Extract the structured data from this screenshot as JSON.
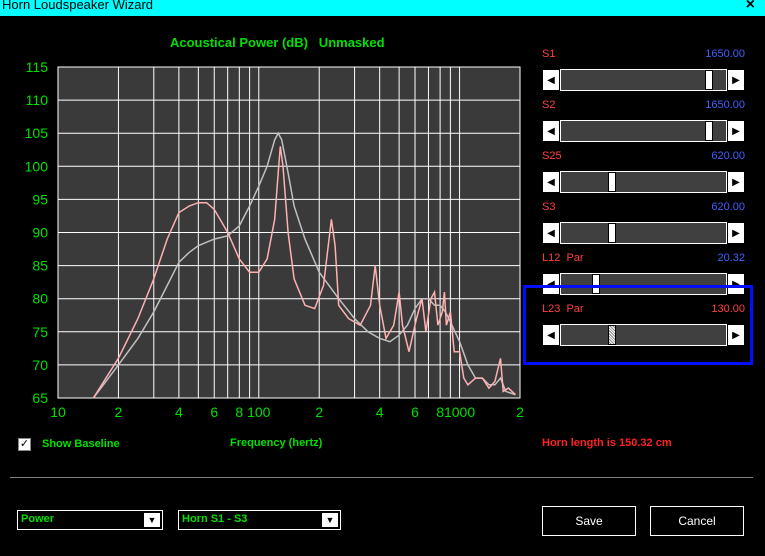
{
  "window": {
    "title": "Horn Loudspeaker Wizard",
    "close_glyph": "×"
  },
  "chart_data": {
    "type": "line",
    "title": "Acoustical Power (dB)   Unmasked",
    "xlabel": "Frequency (hertz)",
    "ylabel": "",
    "x_scale": "log",
    "xlim": [
      10,
      2000
    ],
    "ylim": [
      65,
      115
    ],
    "y_ticks": [
      115,
      110,
      105,
      100,
      95,
      90,
      85,
      80,
      75,
      70,
      65
    ],
    "x_ticks": [
      {
        "value": 10,
        "label": "10"
      },
      {
        "value": 20,
        "label": "2"
      },
      {
        "value": 40,
        "label": "4"
      },
      {
        "value": 60,
        "label": "6"
      },
      {
        "value": 80,
        "label": "8"
      },
      {
        "value": 100,
        "label": "100"
      },
      {
        "value": 200,
        "label": "2"
      },
      {
        "value": 400,
        "label": "4"
      },
      {
        "value": 600,
        "label": "6"
      },
      {
        "value": 800,
        "label": "8"
      },
      {
        "value": 1000,
        "label": "1000"
      },
      {
        "value": 2000,
        "label": "2"
      }
    ],
    "grid": true,
    "colors": {
      "plot_bg": "#3a3a3a",
      "grid": "#ffffff",
      "axis_text": "#00e000",
      "series_1": "#ffb0b0",
      "series_2": "#c0c0c0"
    },
    "series": [
      {
        "color": "#ffb0b0",
        "points": [
          [
            15,
            65
          ],
          [
            20,
            71
          ],
          [
            25,
            77
          ],
          [
            30,
            83
          ],
          [
            35,
            89
          ],
          [
            40,
            93
          ],
          [
            45,
            94
          ],
          [
            50,
            94.5
          ],
          [
            55,
            94.5
          ],
          [
            60,
            93.5
          ],
          [
            70,
            90
          ],
          [
            80,
            86
          ],
          [
            90,
            84
          ],
          [
            100,
            84
          ],
          [
            110,
            86
          ],
          [
            120,
            92
          ],
          [
            125,
            99
          ],
          [
            128,
            103
          ],
          [
            132,
            100
          ],
          [
            140,
            90
          ],
          [
            150,
            83
          ],
          [
            170,
            79
          ],
          [
            190,
            78.5
          ],
          [
            210,
            82
          ],
          [
            230,
            92
          ],
          [
            240,
            88
          ],
          [
            250,
            79
          ],
          [
            280,
            77
          ],
          [
            320,
            76
          ],
          [
            360,
            79
          ],
          [
            380,
            85
          ],
          [
            400,
            79
          ],
          [
            430,
            74
          ],
          [
            470,
            76
          ],
          [
            500,
            81
          ],
          [
            520,
            76
          ],
          [
            560,
            72
          ],
          [
            610,
            77
          ],
          [
            650,
            80
          ],
          [
            680,
            75
          ],
          [
            720,
            80
          ],
          [
            750,
            81
          ],
          [
            780,
            76
          ],
          [
            820,
            78
          ],
          [
            840,
            81
          ],
          [
            860,
            76
          ],
          [
            900,
            78
          ],
          [
            940,
            72
          ],
          [
            1000,
            72
          ],
          [
            1050,
            68
          ],
          [
            1100,
            67
          ],
          [
            1200,
            68
          ],
          [
            1300,
            68
          ],
          [
            1400,
            66.5
          ],
          [
            1500,
            67.5
          ],
          [
            1600,
            71
          ],
          [
            1650,
            66
          ],
          [
            1750,
            66.5
          ],
          [
            1900,
            65.5
          ]
        ]
      },
      {
        "color": "#c0c0c0",
        "points": [
          [
            15,
            65
          ],
          [
            20,
            70
          ],
          [
            25,
            74
          ],
          [
            30,
            78
          ],
          [
            35,
            82
          ],
          [
            40,
            85.5
          ],
          [
            45,
            87
          ],
          [
            50,
            88
          ],
          [
            60,
            89
          ],
          [
            70,
            89.5
          ],
          [
            80,
            91
          ],
          [
            90,
            94
          ],
          [
            100,
            97
          ],
          [
            110,
            100
          ],
          [
            120,
            104
          ],
          [
            125,
            105
          ],
          [
            130,
            104
          ],
          [
            140,
            99
          ],
          [
            150,
            94
          ],
          [
            170,
            89
          ],
          [
            200,
            84
          ],
          [
            250,
            80
          ],
          [
            300,
            77
          ],
          [
            350,
            75
          ],
          [
            400,
            74
          ],
          [
            450,
            73.5
          ],
          [
            500,
            74.5
          ],
          [
            550,
            76
          ],
          [
            600,
            78.5
          ],
          [
            650,
            80
          ],
          [
            700,
            80
          ],
          [
            750,
            79
          ],
          [
            800,
            79
          ],
          [
            850,
            78
          ],
          [
            900,
            76.5
          ],
          [
            1000,
            73.5
          ],
          [
            1100,
            70
          ],
          [
            1200,
            68
          ],
          [
            1300,
            68
          ],
          [
            1400,
            67
          ],
          [
            1500,
            67
          ],
          [
            1600,
            68
          ],
          [
            1700,
            66
          ],
          [
            1900,
            65.5
          ]
        ]
      }
    ]
  },
  "sliders": [
    {
      "label": "S1",
      "value": "1650.00",
      "fraction": 0.92,
      "value_color": "blue"
    },
    {
      "label": "S2",
      "value": "1650.00",
      "fraction": 0.92,
      "value_color": "blue"
    },
    {
      "label": "S25",
      "value": "620.00",
      "fraction": 0.3,
      "value_color": "blue"
    },
    {
      "label": "S3",
      "value": "620.00",
      "fraction": 0.3,
      "value_color": "blue"
    },
    {
      "label": "L12  Par",
      "value": "20.32",
      "fraction": 0.2,
      "value_color": "blue"
    },
    {
      "label": "L23  Par",
      "value": "130.00",
      "fraction": 0.3,
      "value_color": "red"
    }
  ],
  "show_baseline": {
    "label": "Show Baseline",
    "checked": true,
    "check_glyph": "✓"
  },
  "horn_length_text": "Horn length is 150.32 cm",
  "plot_select": {
    "value": "Power"
  },
  "section_select": {
    "value": "Horn S1 - S3"
  },
  "buttons": {
    "save": "Save",
    "cancel": "Cancel"
  }
}
